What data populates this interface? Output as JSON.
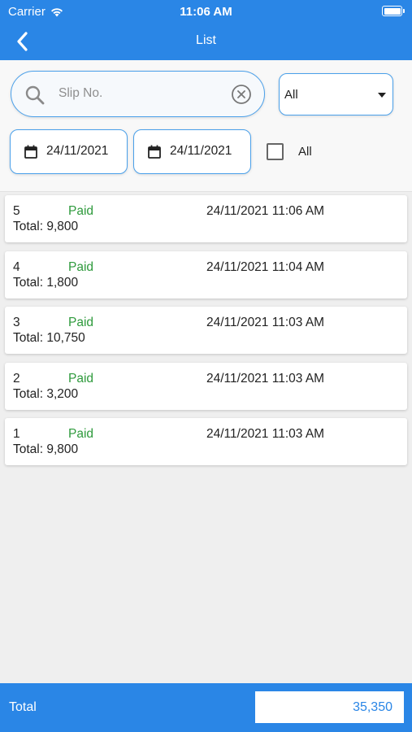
{
  "status_bar": {
    "carrier": "Carrier",
    "time": "11:06 AM"
  },
  "nav": {
    "title": "List"
  },
  "search": {
    "placeholder": "Slip No."
  },
  "filter": {
    "selected": "All"
  },
  "dates": {
    "from": "24/11/2021",
    "to": "24/11/2021"
  },
  "all_checkbox": {
    "label": "All",
    "checked": false
  },
  "slips": [
    {
      "no": "5",
      "status": "Paid",
      "datetime": "24/11/2021 11:06 AM",
      "total": "Total: 9,800"
    },
    {
      "no": "4",
      "status": "Paid",
      "datetime": "24/11/2021 11:04 AM",
      "total": "Total: 1,800"
    },
    {
      "no": "3",
      "status": "Paid",
      "datetime": "24/11/2021 11:03 AM",
      "total": "Total: 10,750"
    },
    {
      "no": "2",
      "status": "Paid",
      "datetime": "24/11/2021 11:03 AM",
      "total": "Total: 3,200"
    },
    {
      "no": "1",
      "status": "Paid",
      "datetime": "24/11/2021 11:03 AM",
      "total": "Total: 9,800"
    }
  ],
  "footer": {
    "label": "Total",
    "value": "35,350"
  },
  "colors": {
    "primary": "#2a86e6",
    "paid": "#2e9a3c",
    "border": "#4aa0ea"
  }
}
